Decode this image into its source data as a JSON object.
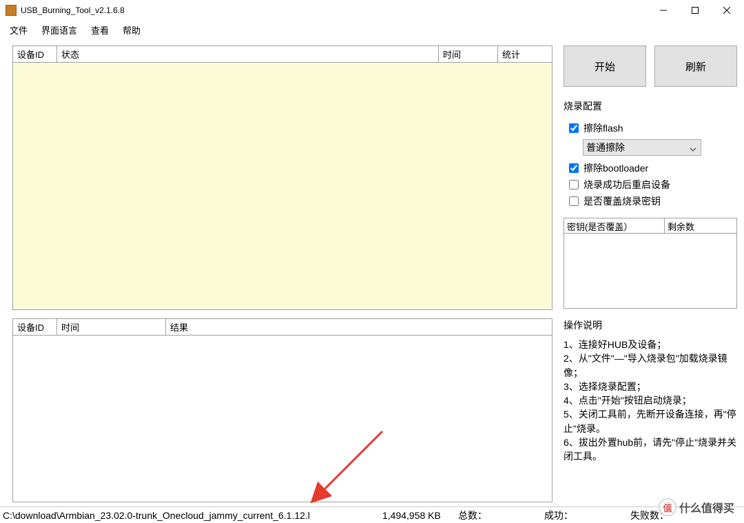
{
  "window": {
    "title": "USB_Burning_Tool_v2.1.6.8"
  },
  "menu": {
    "file": "文件",
    "language": "界面语言",
    "view": "查看",
    "help": "帮助"
  },
  "topTable": {
    "headers": {
      "deviceId": "设备ID",
      "state": "状态",
      "time": "时间",
      "stat": "统计"
    }
  },
  "bottomTable": {
    "headers": {
      "deviceId": "设备ID",
      "time": "时间",
      "result": "结果"
    }
  },
  "buttons": {
    "start": "开始",
    "refresh": "刷新"
  },
  "config": {
    "title": "烧录配置",
    "eraseFlash": {
      "label": "擦除flash",
      "checked": true
    },
    "eraseMode": {
      "selected": "普通擦除"
    },
    "eraseBootloader": {
      "label": "擦除bootloader",
      "checked": true
    },
    "rebootAfter": {
      "label": "烧录成功后重启设备",
      "checked": false
    },
    "overwriteKey": {
      "label": "是否覆盖烧录密钥",
      "checked": false
    }
  },
  "keyTable": {
    "headers": {
      "key": "密钥(是否覆盖）",
      "remain": "剩余数"
    }
  },
  "instructions": {
    "title": "操作说明",
    "lines": [
      "1、连接好HUB及设备；",
      "2、从\"文件\"—\"导入烧录包\"加载烧录镜像；",
      "3、选择烧录配置；",
      "4、点击\"开始\"按钮启动烧录；",
      "5、关闭工具前，先断开设备连接，再\"停止\"烧录。",
      "6、拔出外置hub前，请先\"停止\"烧录并关闭工具。"
    ]
  },
  "status": {
    "path": "C:\\download\\Armbian_23.02.0-trunk_Onecloud_jammy_current_6.1.12.l",
    "size": "1,494,958 KB",
    "totalLabel": "总数：",
    "successLabel": "成功：",
    "failLabel": "失败数："
  },
  "watermark": {
    "badge": "值",
    "text": "什么值得买"
  }
}
